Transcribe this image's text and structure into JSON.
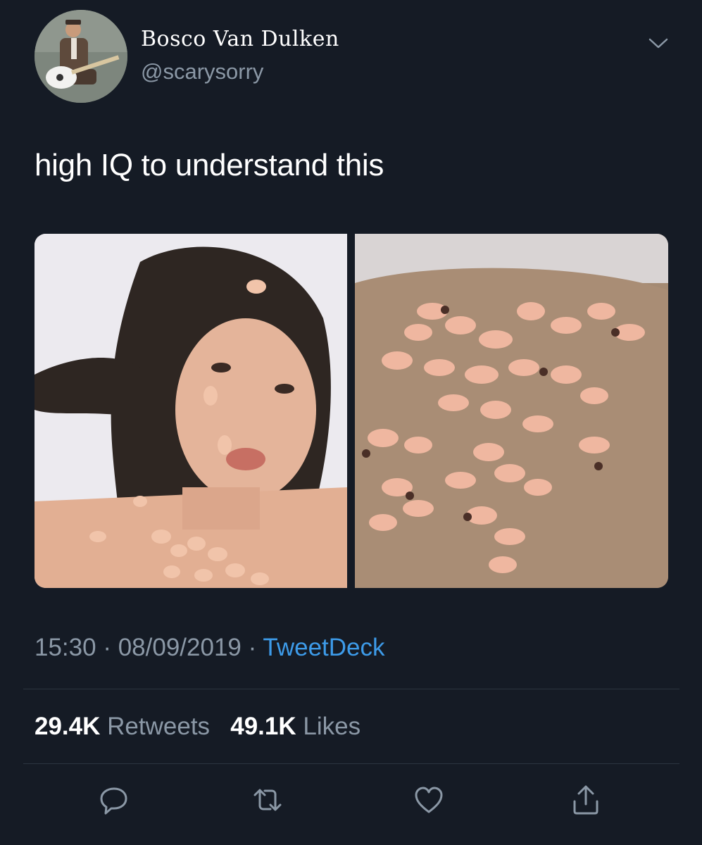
{
  "user": {
    "display_name": "Bosco Van Dulken",
    "handle": "@scarysorry",
    "avatar_icon": "avatar-guitarist"
  },
  "tweet": {
    "text": "high IQ to understand this",
    "media": [
      {
        "icon": "photo-selfie-with-doll-figurines"
      },
      {
        "icon": "photo-chest-covered-with-doll-figurines"
      }
    ],
    "time": "15:30",
    "date": "08/09/2019",
    "separator": "·",
    "source": "TweetDeck"
  },
  "stats": {
    "retweets_count": "29.4K",
    "retweets_label": "Retweets",
    "likes_count": "49.1K",
    "likes_label": "Likes"
  },
  "actions": {
    "reply_icon": "reply-icon",
    "retweet_icon": "retweet-icon",
    "like_icon": "heart-icon",
    "share_icon": "share-icon"
  },
  "colors": {
    "background": "#151b25",
    "muted_text": "#8b98a6",
    "link": "#3d9be9"
  }
}
